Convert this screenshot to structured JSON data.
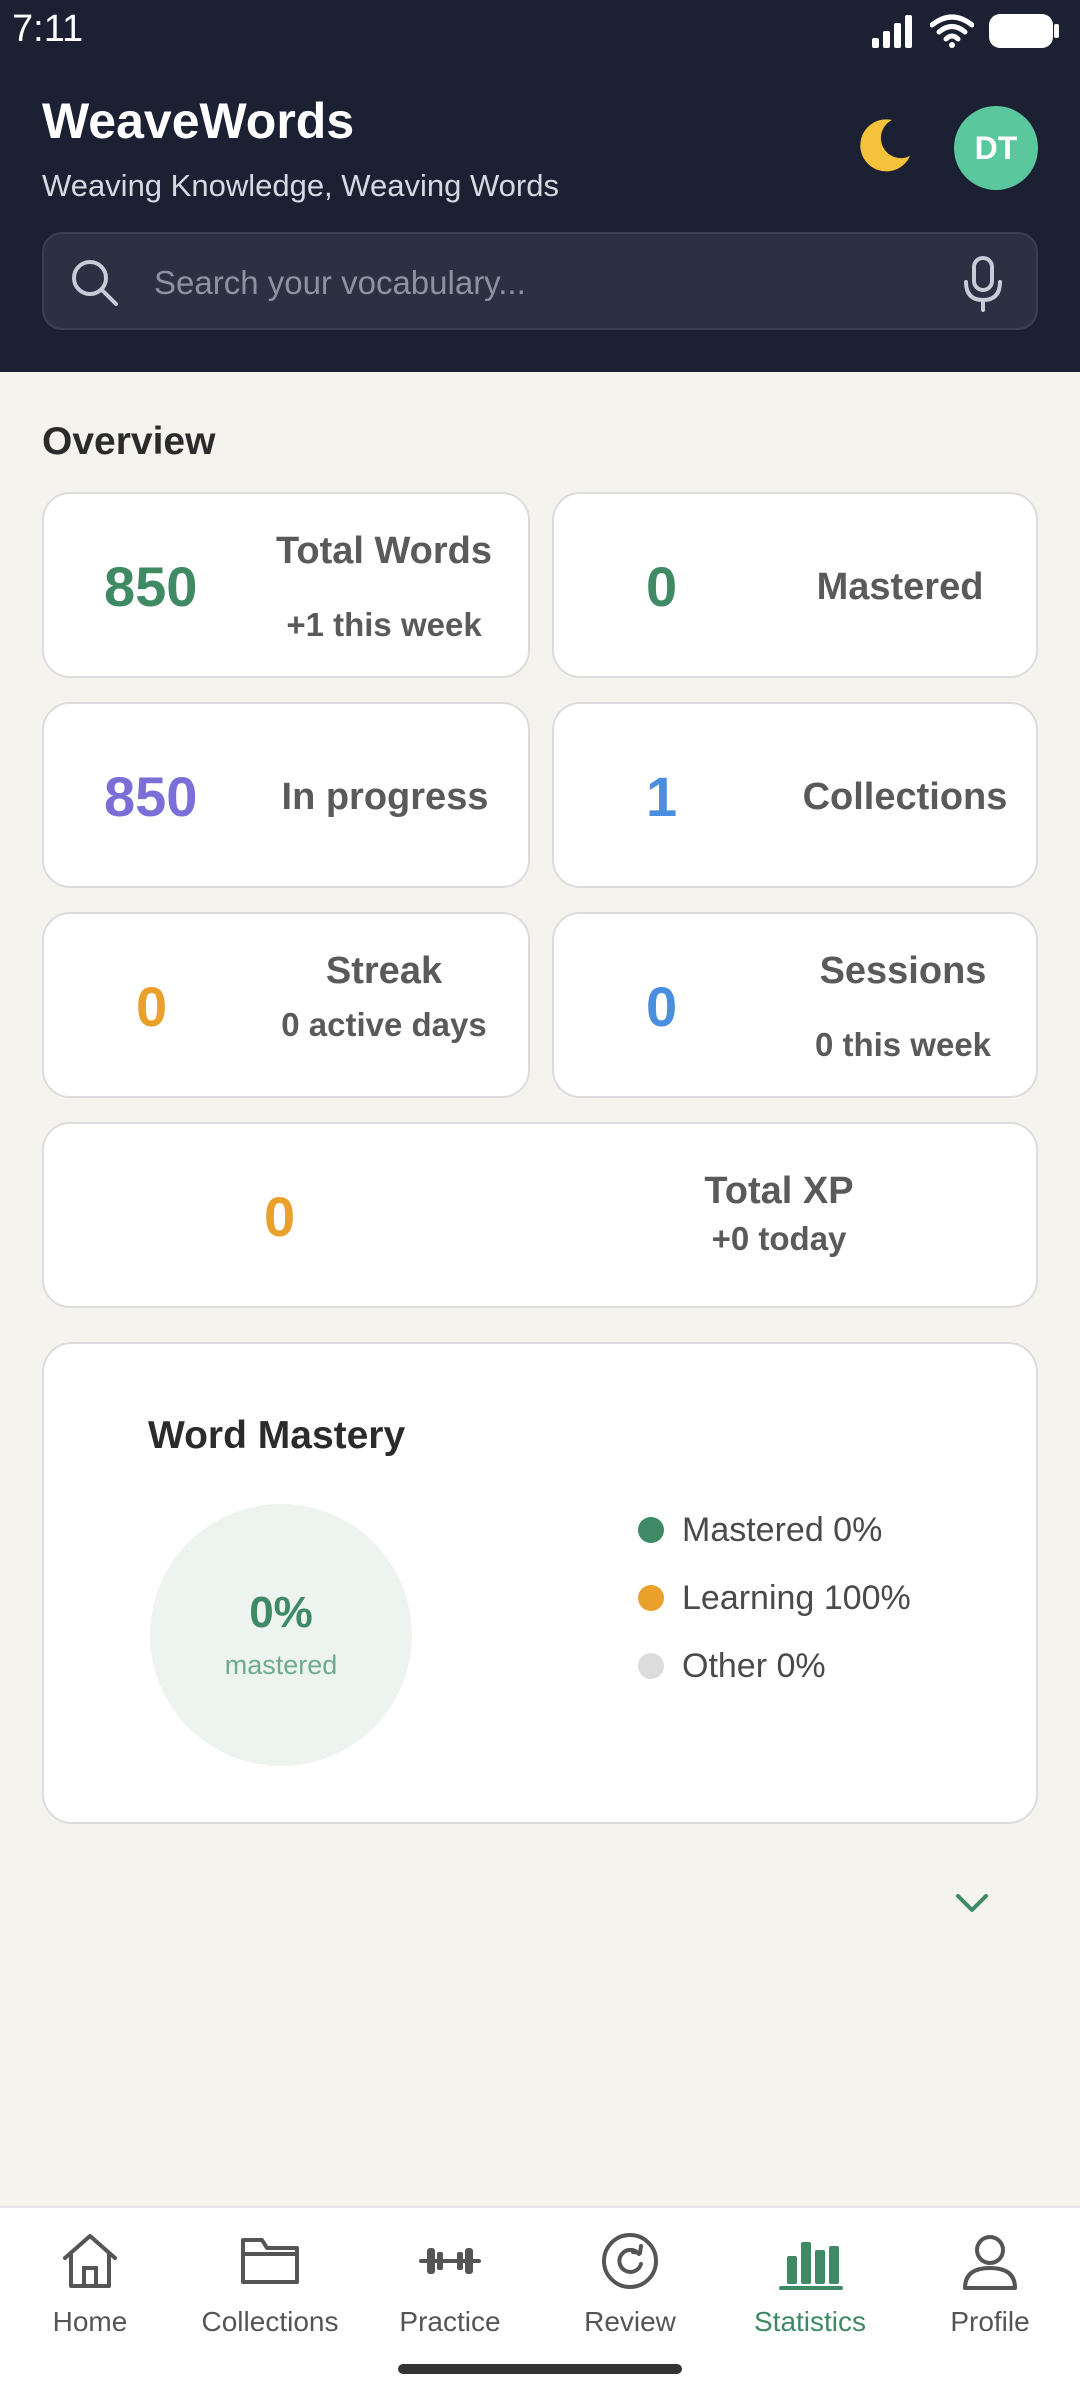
{
  "status_bar": {
    "time": "7:11"
  },
  "header": {
    "title": "WeaveWords",
    "subtitle": "Weaving Knowledge, Weaving Words",
    "avatar_initials": "DT"
  },
  "search": {
    "placeholder": "Search your vocabulary..."
  },
  "overview": {
    "title": "Overview",
    "total_words": {
      "value": "850",
      "label": "Total Words",
      "sub": "+1 this week"
    },
    "mastered": {
      "value": "0",
      "label": "Mastered"
    },
    "in_progress": {
      "value": "850",
      "label": "In progress"
    },
    "collections": {
      "value": "1",
      "label": "Collections"
    },
    "streak": {
      "value": "0",
      "label": "Streak",
      "sub": "0 active days"
    },
    "sessions": {
      "value": "0",
      "label": "Sessions",
      "sub": "0 this week"
    },
    "total_xp": {
      "value": "0",
      "label": "Total XP",
      "sub": "+0 today"
    }
  },
  "word_mastery": {
    "title": "Word Mastery",
    "center_value": "0%",
    "center_label": "mastered",
    "legend": [
      {
        "label": "Mastered 0%",
        "color": "#3f8a65"
      },
      {
        "label": "Learning 100%",
        "color": "#e9a12b"
      },
      {
        "label": "Other 0%",
        "color": "#dcdcdc"
      }
    ]
  },
  "colors": {
    "green": "#3f8a65",
    "purple": "#7a6fd6",
    "blue": "#4a8ee0",
    "orange": "#e9a12b",
    "header_bg": "#1b2033"
  },
  "bottom_nav": [
    {
      "label": "Home",
      "icon": "home-icon"
    },
    {
      "label": "Collections",
      "icon": "folder-icon"
    },
    {
      "label": "Practice",
      "icon": "dumbbell-icon"
    },
    {
      "label": "Review",
      "icon": "refresh-icon"
    },
    {
      "label": "Statistics",
      "icon": "bar-chart-icon",
      "active": true
    },
    {
      "label": "Profile",
      "icon": "user-icon"
    }
  ]
}
